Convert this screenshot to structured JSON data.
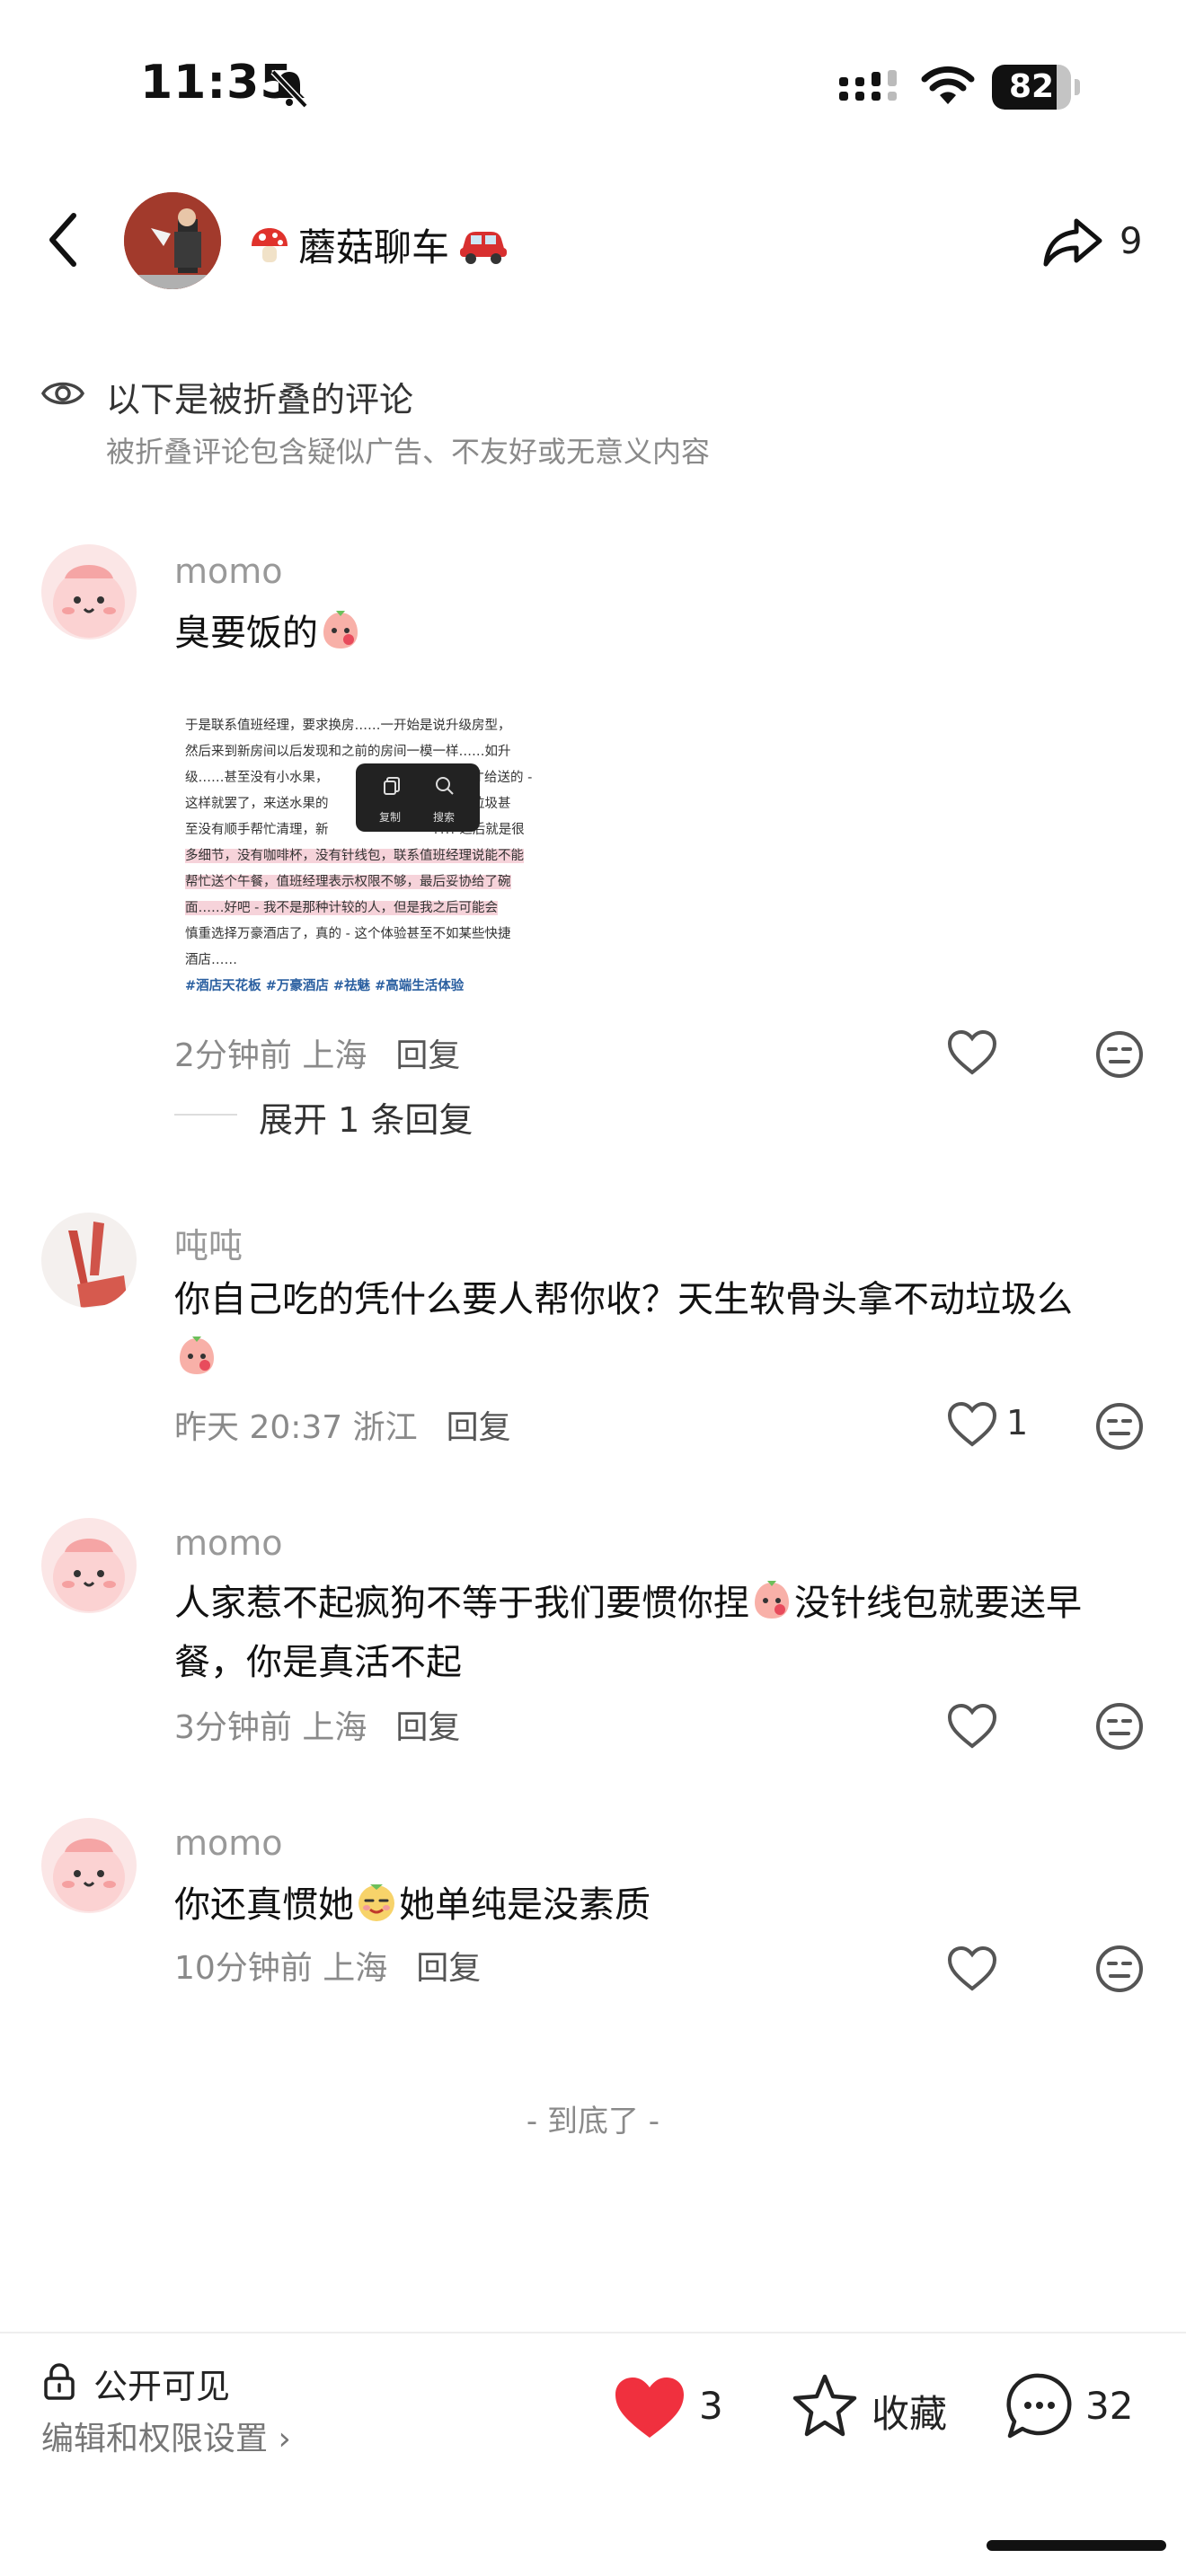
{
  "status_bar": {
    "time": "11:35",
    "battery": "82",
    "battery_level": 0.82
  },
  "header": {
    "title": "蘑菇聊车",
    "title_prefix_icon": "mushroom",
    "title_suffix_icon": "red-car",
    "share_count": "9"
  },
  "folded": {
    "title": "以下是被折叠的评论",
    "subtitle": "被折叠评论包含疑似广告、不友好或无意义内容"
  },
  "comments": [
    {
      "user": "momo",
      "text": "臭要饭的",
      "time": "2分钟前",
      "location": "上海",
      "reply_label": "回复",
      "likes": "",
      "expand_label": "展开 1 条回复",
      "image": {
        "lines": [
          "于是联系值班经理，要求换房……一开始是说升级房型，",
          "然后来到新房间以后发现和之前的房间一模一样……如升",
          "级……甚至没有小水果，",
          "这样就罢了，来送水果的",
          "至没有顺手帮忙清理，新",
          "多细节，没有咖啡杯，没有针线包，联系值班经理说能不能",
          "帮忙送个午餐，值班经理表示权限不够，最后妥协给了碗",
          "面……好吧 - 我不是那种计较的人，但是我之后可能会",
          "慎重选择万豪酒店了，真的 - 这个体验甚至不如某些快捷",
          "酒店……"
        ],
        "line_tails": [
          "",
          "",
          "要求才给送的 -",
          "的果皮垃圾甚",
          "?!!! 之后就是很",
          "",
          "",
          "",
          "",
          ""
        ],
        "tags": "#酒店天花板 #万豪酒店 #祛魅 #高端生活体验",
        "popup_copy": "复制",
        "popup_search": "搜索"
      }
    },
    {
      "user": "吨吨",
      "text": "你自己吃的凭什么要人帮你收？天生软骨头拿不动垃圾么",
      "time": "昨天 20:37",
      "location": "浙江",
      "reply_label": "回复",
      "likes": "1"
    },
    {
      "user": "momo",
      "text_part1": "人家惹不起疯狗不等于我们要惯你捏",
      "text_part2": "没针线包就要送早",
      "text_line2": "餐，你是真活不起",
      "time": "3分钟前",
      "location": "上海",
      "reply_label": "回复",
      "likes": ""
    },
    {
      "user": "momo",
      "text_part1": "你还真惯她",
      "text_part2": "她单纯是没素质",
      "time": "10分钟前",
      "location": "上海",
      "reply_label": "回复",
      "likes": ""
    }
  ],
  "end_label": "- 到底了 -",
  "bottom": {
    "visibility": "公开可见",
    "permission": "编辑和权限设置 ›",
    "likes": "3",
    "favorite_label": "收藏",
    "comments": "32"
  },
  "colors": {
    "like_red": "#f0303e",
    "highlight_pink": "#f6d3da",
    "avatar_pink": "#fbd9d9",
    "channel_avatar_red": "#a23a2c"
  }
}
